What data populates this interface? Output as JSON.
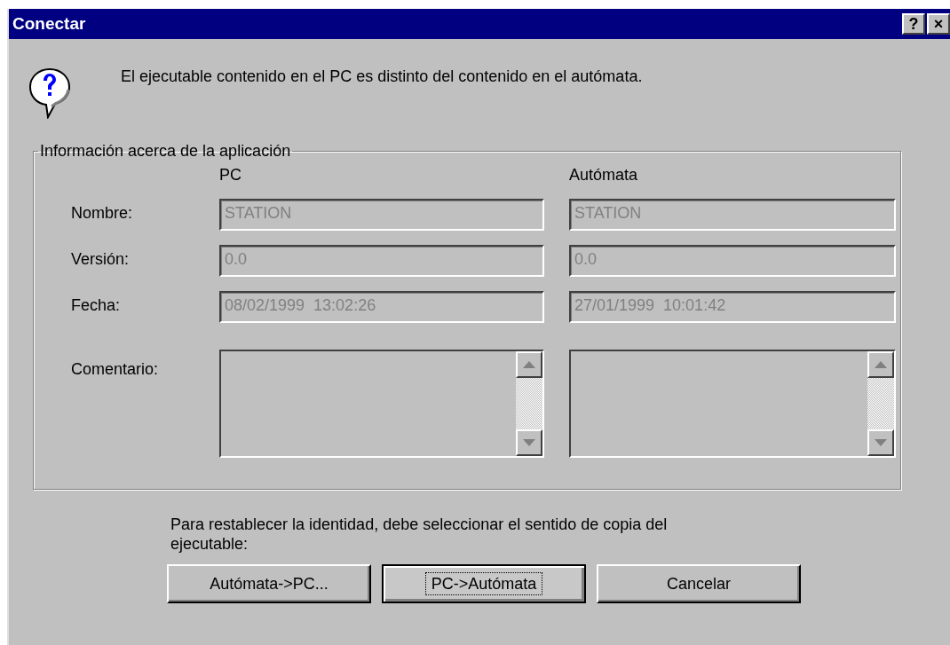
{
  "window": {
    "title": "Conectar",
    "title_buttons": [
      "?",
      "×"
    ]
  },
  "message": "El ejecutable contenido en el PC es distinto del contenido en el autómata.",
  "group": {
    "title": "Información acerca de la aplicación",
    "columns": [
      "PC",
      "Autómata"
    ],
    "rows": [
      {
        "kind": "field",
        "label": "Nombre:",
        "values": [
          "STATION",
          "STATION"
        ],
        "disabled": true
      },
      {
        "kind": "field",
        "label": "Versión:",
        "values": [
          "0.0",
          "0.0"
        ],
        "disabled": true
      },
      {
        "kind": "field",
        "label": "Fecha:",
        "values": [
          "08/02/1999  13:02:26",
          "27/01/1999  10:01:42"
        ],
        "disabled": true
      },
      {
        "kind": "memo",
        "label": "Comentario:",
        "disabled": true
      }
    ]
  },
  "instruction": "Para restablecer la identidad, debe seleccionar el sentido de copia del ejecutable:",
  "buttons": [
    {
      "label": "Autómata->PC...",
      "focused": false
    },
    {
      "label": "PC->Autómata",
      "focused": true
    },
    {
      "label": "Cancelar",
      "focused": false
    }
  ]
}
